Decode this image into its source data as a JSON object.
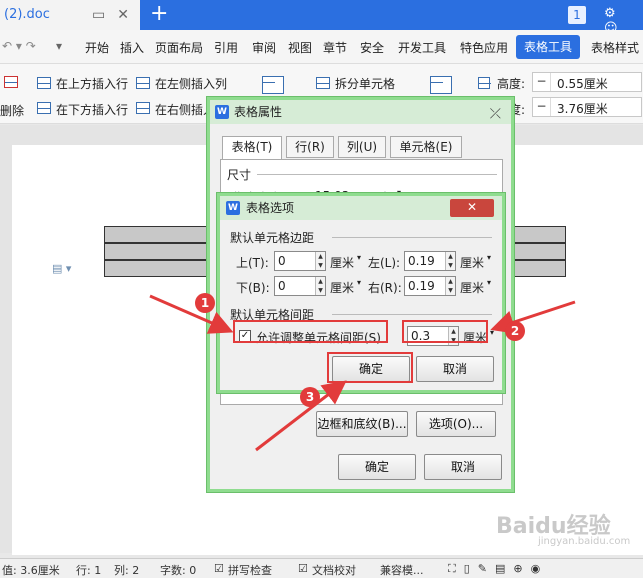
{
  "window": {
    "doc_tab": "(2).doc",
    "page_number": "1"
  },
  "menu": {
    "items": [
      "开始",
      "插入",
      "页面布局",
      "引用",
      "审阅",
      "视图",
      "章节",
      "安全",
      "开发工具",
      "特色应用"
    ],
    "active": "表格工具",
    "last": "表格样式"
  },
  "ribbon": {
    "delete": "删除",
    "insert_above": "在上方插入行",
    "insert_below": "在下方插入行",
    "insert_left": "在左侧插入列",
    "insert_right": "在右侧插入列",
    "split_cells": "拆分单元格",
    "height_label": "高度:",
    "height_value": "0.55厘米",
    "width_label": "度:",
    "width_value": "3.76厘米"
  },
  "props_dialog": {
    "title": "表格属性",
    "tabs": [
      "表格(T)",
      "行(R)",
      "列(U)",
      "单元格(E)"
    ],
    "size_label": "尺寸",
    "width_label": "指定宽度(W):",
    "width_value": "15.03",
    "width_unit": "厘米",
    "borders_button": "边框和底纹(B)...",
    "options_button": "选项(O)...",
    "ok": "确定",
    "cancel": "取消"
  },
  "options_dialog": {
    "title": "表格选项",
    "close": "✕",
    "margins_group": "默认单元格边距",
    "top_label": "上(T):",
    "top_value": "0",
    "left_label": "左(L):",
    "left_value": "0.19",
    "bottom_label": "下(B):",
    "bottom_value": "0",
    "right_label": "右(R):",
    "right_value": "0.19",
    "unit": "厘米",
    "spacing_group": "默认单元格间距",
    "allow_spacing_label": "允许调整单元格间距(S)",
    "spacing_value": "0.3",
    "ok": "确定",
    "cancel": "取消"
  },
  "annotations": [
    "1",
    "2",
    "3"
  ],
  "status": {
    "value": "值: 3.6厘米",
    "row": "行: 1",
    "col": "列: 2",
    "words": "字数: 0",
    "spell": "拼写检查",
    "proof": "文档校对",
    "compat": "兼容模..."
  },
  "watermark": "Baidu经验",
  "watermark_sub": "jingyan.baidu.com",
  "colors": {
    "accent": "#2b6fe0",
    "dialog_border": "#8fdc8f",
    "annotation_red": "#e23b3b"
  }
}
